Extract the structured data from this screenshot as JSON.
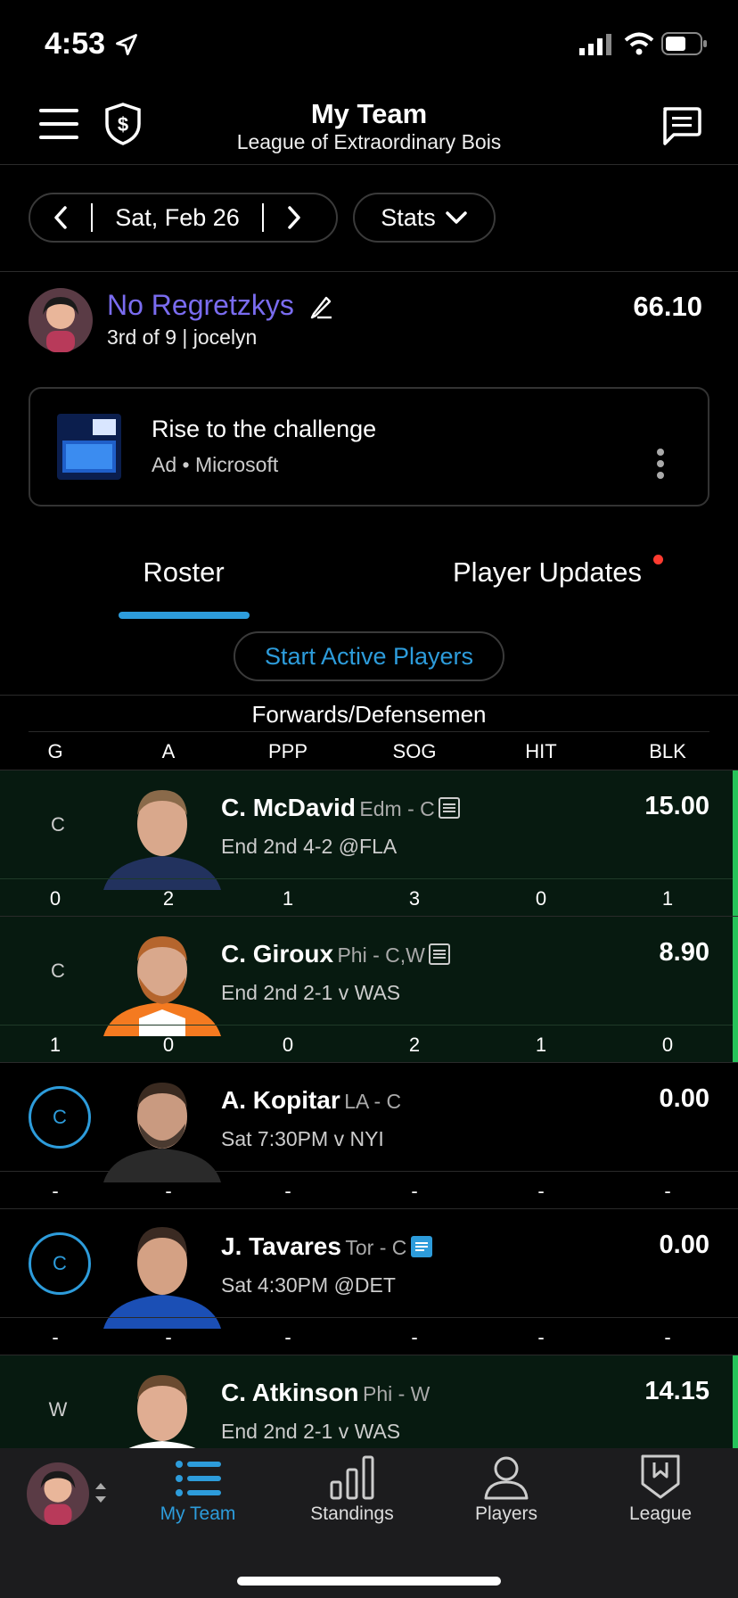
{
  "status": {
    "time": "4:53"
  },
  "header": {
    "title": "My Team",
    "subtitle": "League of Extraordinary Bois"
  },
  "datebar": {
    "date": "Sat, Feb 26",
    "stats_label": "Stats"
  },
  "team": {
    "name": "No Regretzkys",
    "rank": "3rd of 9 | jocelyn",
    "score": "66.10"
  },
  "ad": {
    "title": "Rise to the challenge",
    "source": "Ad • Microsoft"
  },
  "tabs": {
    "roster": "Roster",
    "updates": "Player Updates"
  },
  "start_button": "Start Active Players",
  "section": "Forwards/Defensemen",
  "columns": [
    "G",
    "A",
    "PPP",
    "SOG",
    "HIT",
    "BLK"
  ],
  "players": [
    {
      "pos": "C",
      "name": "C. McDavid",
      "team": "Edm - C",
      "game": "End 2nd 4-2 @FLA",
      "points": "15.00",
      "stats": [
        "0",
        "2",
        "1",
        "3",
        "0",
        "1"
      ]
    },
    {
      "pos": "C",
      "name": "C. Giroux",
      "team": "Phi - C,W",
      "game": "End 2nd 2-1 v WAS",
      "points": "8.90",
      "stats": [
        "1",
        "0",
        "0",
        "2",
        "1",
        "0"
      ]
    },
    {
      "pos": "C",
      "name": "A. Kopitar",
      "team": "LA - C",
      "game": "Sat 7:30PM v NYI",
      "points": "0.00",
      "stats": [
        "-",
        "-",
        "-",
        "-",
        "-",
        "-"
      ]
    },
    {
      "pos": "C",
      "name": "J. Tavares",
      "team": "Tor - C",
      "game": "Sat 4:30PM @DET",
      "points": "0.00",
      "stats": [
        "-",
        "-",
        "-",
        "-",
        "-",
        "-"
      ]
    },
    {
      "pos": "W",
      "name": "C. Atkinson",
      "team": "Phi - W",
      "game": "End 2nd 2-1 v WAS",
      "points": "14.15",
      "stats": []
    }
  ],
  "nav": {
    "myteam": "My Team",
    "standings": "Standings",
    "players": "Players",
    "league": "League"
  },
  "colors": {
    "accent": "#2d9cdb",
    "team_name": "#7a6cf0",
    "active_bg": "#071a10",
    "active_bar": "#27c25a"
  }
}
